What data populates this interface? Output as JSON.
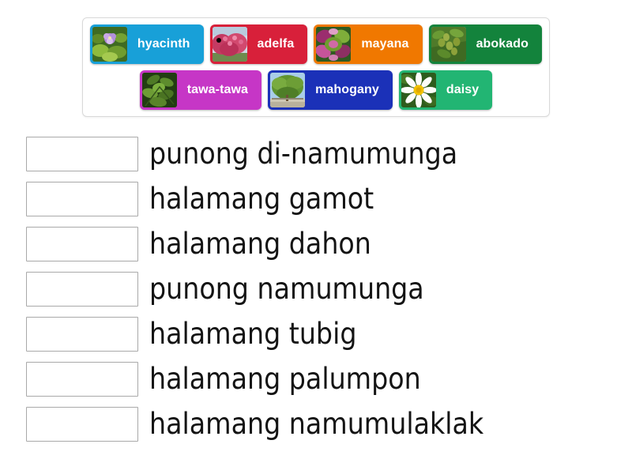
{
  "word_bank": {
    "rows": [
      [
        {
          "label": "hyacinth",
          "color": "#18a0d8",
          "image": "water-hyacinth-photo"
        },
        {
          "label": "adelfa",
          "color": "#d8203a",
          "image": "adelfa-shrub-photo"
        },
        {
          "label": "mayana",
          "color": "#f07800",
          "image": "mayana-leaves-photo"
        },
        {
          "label": "abokado",
          "color": "#13833c",
          "image": "avocado-tree-photo"
        }
      ],
      [
        {
          "label": "tawa-tawa",
          "color": "#c636c6",
          "image": "tawa-tawa-plant-photo"
        },
        {
          "label": "mahogany",
          "color": "#1b31b8",
          "image": "mahogany-tree-photo"
        },
        {
          "label": "daisy",
          "color": "#22b573",
          "image": "daisy-flower-photo"
        }
      ]
    ]
  },
  "answers": {
    "rows": [
      {
        "label": "punong di-namumunga"
      },
      {
        "label": "halamang gamot"
      },
      {
        "label": "halamang dahon"
      },
      {
        "label": "punong namumunga"
      },
      {
        "label": "halamang tubig"
      },
      {
        "label": "halamang palumpon"
      },
      {
        "label": "halamang namumulaklak"
      }
    ]
  }
}
